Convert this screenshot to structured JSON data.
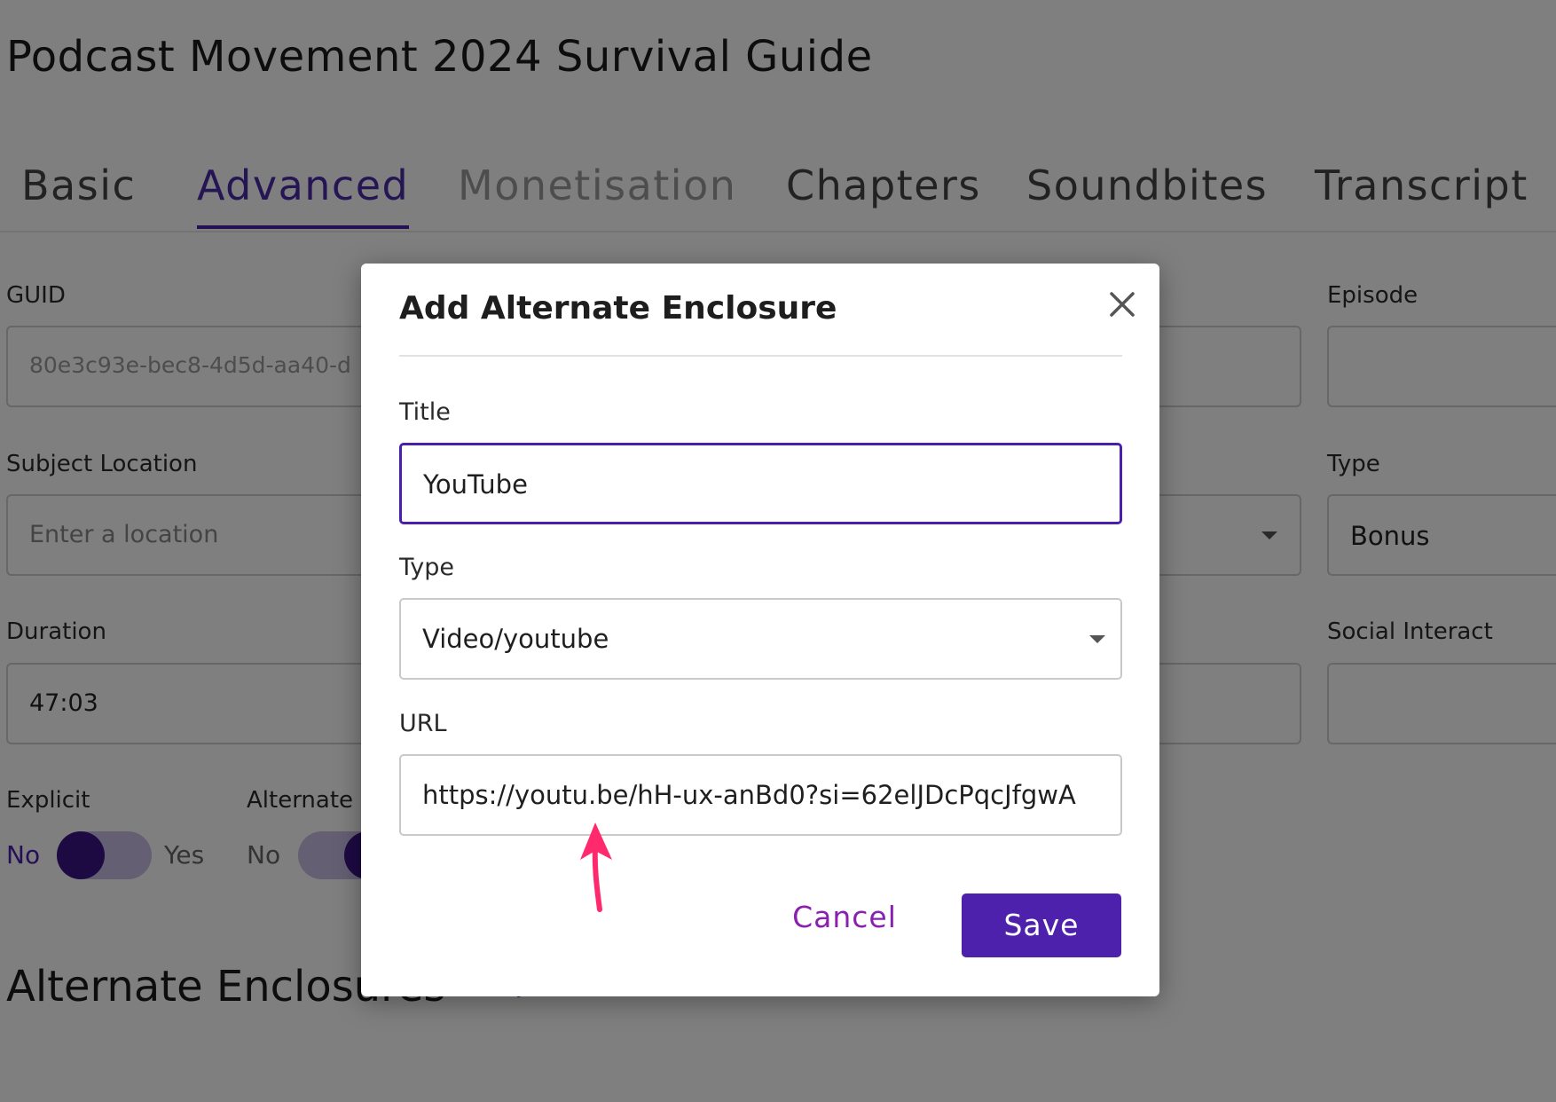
{
  "episode": {
    "title": "Podcast Movement 2024 Survival Guide"
  },
  "tabs": [
    {
      "label": "Basic"
    },
    {
      "label": "Advanced"
    },
    {
      "label": "Monetisation"
    },
    {
      "label": "Chapters"
    },
    {
      "label": "Soundbites"
    },
    {
      "label": "Transcript"
    }
  ],
  "form": {
    "guid_label": "GUID",
    "guid_value": "80e3c93e-bec8-4d5d-aa40-d",
    "subject_location_label": "Subject Location",
    "subject_location_placeholder": "Enter a location",
    "duration_label": "Duration",
    "duration_value": "47:03",
    "explicit_label": "Explicit",
    "explicit_no": "No",
    "explicit_yes": "Yes",
    "alternate_label": "Alternate",
    "alternate_no": "No",
    "episode_label": "Episode",
    "type_label": "Type",
    "type_value": "Bonus",
    "social_label": "Social Interact"
  },
  "section": {
    "alternate_enclosures_heading": "Alternate Enclosures"
  },
  "modal": {
    "title": "Add Alternate Enclosure",
    "title_label": "Title",
    "title_value": "YouTube",
    "type_label": "Type",
    "type_value": "Video/youtube",
    "url_label": "URL",
    "url_value": "https://youtu.be/hH-ux-anBd0?si=62elJDcPqcJfgwA",
    "cancel_label": "Cancel",
    "save_label": "Save"
  },
  "colors": {
    "accent": "#4a1fae",
    "cancel_text": "#8a1fb0",
    "annotation_arrow": "#ff2a6d"
  },
  "icons": {
    "close": "close-icon",
    "dropdown": "chevron-down-icon",
    "annotation": "arrow-up-icon"
  }
}
